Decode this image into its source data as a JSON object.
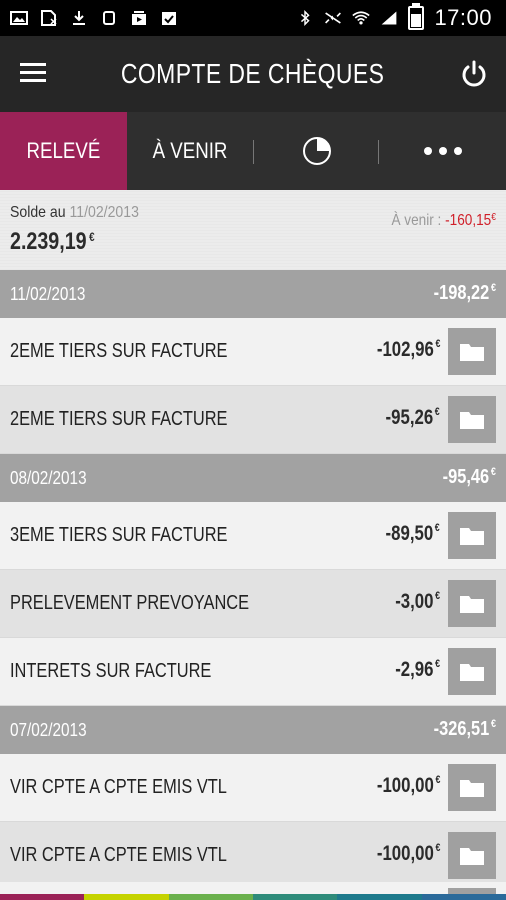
{
  "status_bar": {
    "time": "17:00",
    "icons": [
      "gallery-icon",
      "sim-icon",
      "download-icon",
      "watch-icon",
      "video-icon",
      "clipboard-icon",
      "bluetooth-icon",
      "mute-icon",
      "wifi-icon",
      "signal-icon",
      "battery-icon"
    ]
  },
  "app_bar": {
    "title": "COMPTE DE CHÈQUES",
    "menu_icon": "hamburger-icon",
    "power_icon": "power-icon"
  },
  "tabs": [
    {
      "label": "RELEVÉ",
      "active": true
    },
    {
      "label": "À VENIR",
      "active": false
    },
    {
      "label": "",
      "icon": "pie-chart-icon",
      "active": false
    },
    {
      "label": "",
      "icon": "more-dots-icon",
      "active": false
    }
  ],
  "balance": {
    "label": "Solde au ",
    "date": "11/02/2013",
    "amount": "2.239,19",
    "currency": "€",
    "avenir_label": "À venir : ",
    "avenir_amount": "-160,15",
    "avenir_currency": "€"
  },
  "days": [
    {
      "date": "11/02/2013",
      "total": "-198,22",
      "currency": "€",
      "transactions": [
        {
          "label": "2EME TIERS SUR FACTURE",
          "amount": "-102,96",
          "currency": "€"
        },
        {
          "label": "2EME TIERS SUR FACTURE",
          "amount": "-95,26",
          "currency": "€"
        }
      ]
    },
    {
      "date": "08/02/2013",
      "total": "-95,46",
      "currency": "€",
      "transactions": [
        {
          "label": "3EME TIERS SUR FACTURE",
          "amount": "-89,50",
          "currency": "€"
        },
        {
          "label": "PRELEVEMENT PREVOYANCE",
          "amount": "-3,00",
          "currency": "€"
        },
        {
          "label": "INTERETS SUR FACTURE",
          "amount": "-2,96",
          "currency": "€"
        }
      ]
    },
    {
      "date": "07/02/2013",
      "total": "-326,51",
      "currency": "€",
      "transactions": [
        {
          "label": "VIR CPTE A CPTE EMIS VTL",
          "amount": "-100,00",
          "currency": "€"
        },
        {
          "label": "VIR CPTE A CPTE EMIS VTL",
          "amount": "-100,00",
          "currency": "€"
        }
      ]
    }
  ],
  "colors": {
    "accent": "#9b2257",
    "negative": "#d0202a",
    "bottom_strip": [
      "#9b2257",
      "#c5d300",
      "#6ab04c",
      "#2e8b7a",
      "#1e7a8c",
      "#2b6a9a"
    ]
  }
}
